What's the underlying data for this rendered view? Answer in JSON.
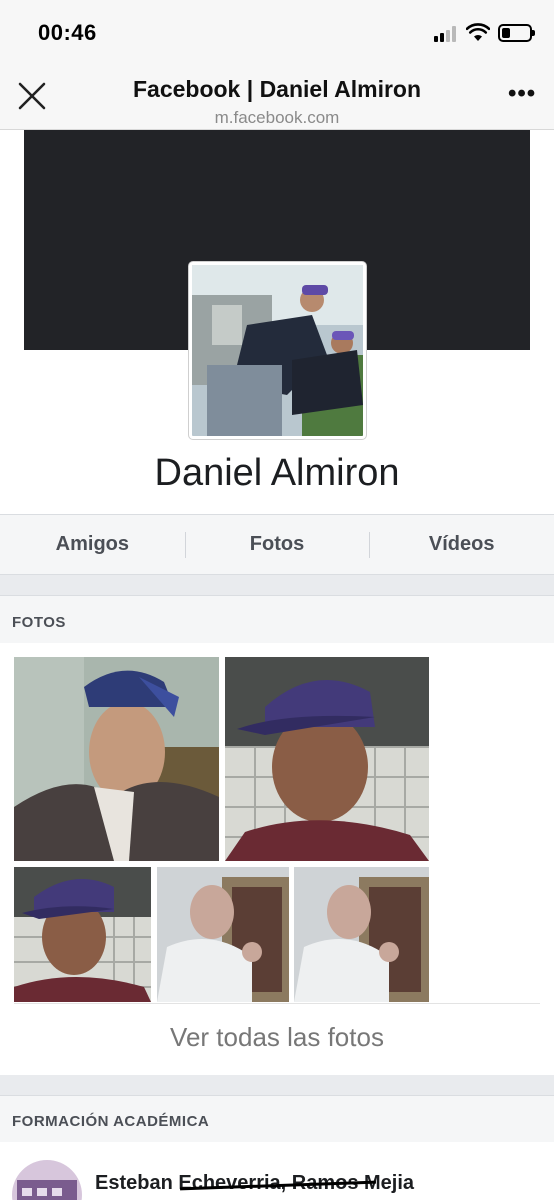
{
  "status_bar": {
    "time": "00:46",
    "battery_level": 0.3
  },
  "browser": {
    "title": "Facebook | Daniel Almiron",
    "url": "m.facebook.com",
    "more_label": "•••"
  },
  "profile": {
    "name": "Daniel Almiron"
  },
  "tabs": [
    {
      "label": "Amigos"
    },
    {
      "label": "Fotos"
    },
    {
      "label": "Vídeos"
    }
  ],
  "photos_section": {
    "header": "FOTOS",
    "see_all": "Ver todas las fotos"
  },
  "education_section": {
    "header": "FORMACIÓN ACADÉMICA",
    "item_name": "Esteban Echeverria, Ramos Mejia"
  },
  "colors": {
    "cover": "#222327",
    "section_bg": "#f5f6f7",
    "gap": "#e9ebee"
  }
}
